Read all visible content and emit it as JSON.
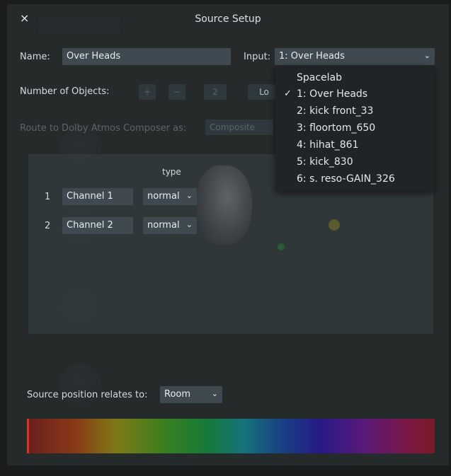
{
  "dialog": {
    "title": "Source Setup",
    "close_label": "×",
    "name_label": "Name:",
    "name_value": "Over Heads",
    "input_label": "Input:",
    "input_value": "1: Over Heads",
    "objects_label": "Number of Objects:",
    "objects_plus": "+",
    "objects_minus": "−",
    "objects_count": "2",
    "lo_button": "Lo",
    "route_label": "Route to Dolby Atmos Composer as:",
    "route_value": "Composite",
    "type_header": "type",
    "channels": [
      {
        "num": "1",
        "name": "Channel 1",
        "type": "normal"
      },
      {
        "num": "2",
        "name": "Channel 2",
        "type": "normal"
      }
    ],
    "position_label": "Source position relates to:",
    "position_value": "Room"
  },
  "input_dropdown": {
    "items": [
      "Spacelab",
      "1: Over Heads",
      "2: kick front_33",
      "3: floortom_650",
      "4: hihat_861",
      "5: kick_830",
      "6: s. reso-GAIN_326"
    ],
    "selected_index": 1,
    "check": "✓"
  },
  "colors": {
    "dialog_bg": "#272c2e",
    "field_bg": "#3f494f",
    "dropdown_bg": "#1f2426",
    "accent_red": "#e2321e"
  }
}
